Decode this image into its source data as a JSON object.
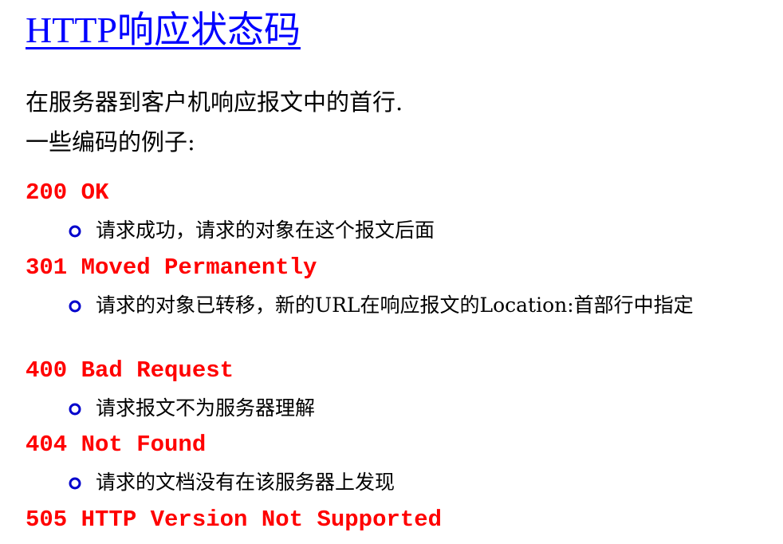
{
  "title": "HTTP响应状态码",
  "intro": {
    "line1": "在服务器到客户机响应报文中的首行.",
    "line2": "一些编码的例子:"
  },
  "codes": [
    {
      "code": "200 OK",
      "description": "请求成功，请求的对象在这个报文后面"
    },
    {
      "code": "301 Moved Permanently",
      "description": "请求的对象已转移，新的URL在响应报文的Location:首部行中指定"
    },
    {
      "code": "400 Bad Request",
      "description": "请求报文不为服务器理解"
    },
    {
      "code": "404 Not Found",
      "description": "请求的文档没有在该服务器上发现"
    },
    {
      "code": "505 HTTP Version Not Supported"
    }
  ],
  "colors": {
    "title": "#0000ff",
    "code": "#ff0000",
    "bullet": "#0000cc"
  },
  "icons": {
    "bullet": "hollow-circle-bullet-icon"
  }
}
